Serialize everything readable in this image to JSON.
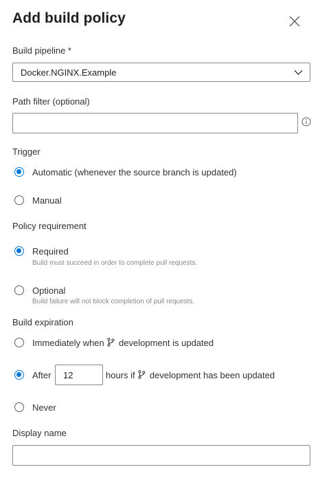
{
  "dialog": {
    "title": "Add build policy"
  },
  "build_pipeline": {
    "label": "Build pipeline *",
    "selected": "Docker.NGINX.Example"
  },
  "path_filter": {
    "label": "Path filter (optional)",
    "value": ""
  },
  "trigger": {
    "label": "Trigger",
    "options": [
      {
        "label": "Automatic (whenever the source branch is updated)",
        "selected": true
      },
      {
        "label": "Manual",
        "selected": false
      }
    ]
  },
  "policy_requirement": {
    "label": "Policy requirement",
    "options": [
      {
        "label": "Required",
        "description": "Build must succeed in order to complete pull requests.",
        "selected": true
      },
      {
        "label": "Optional",
        "description": "Build failure will not block completion of pull requests.",
        "selected": false
      }
    ]
  },
  "build_expiration": {
    "label": "Build expiration",
    "immediately": {
      "prefix": "Immediately when",
      "branch": "development",
      "suffix": "is updated",
      "selected": false
    },
    "after": {
      "prefix": "After",
      "hours": "12",
      "middle": "hours if",
      "branch": "development",
      "suffix": "has been updated",
      "selected": true
    },
    "never": {
      "label": "Never",
      "selected": false
    }
  },
  "display_name": {
    "label": "Display name",
    "value": ""
  },
  "icons": {
    "close": "close-icon",
    "dropdown": "chevron-down-icon",
    "info": "info-icon",
    "branch": "branch-icon"
  },
  "colors": {
    "accent": "#0078d4",
    "text": "#201f1e",
    "secondary_text": "#8a8886",
    "border": "#8a8886"
  }
}
